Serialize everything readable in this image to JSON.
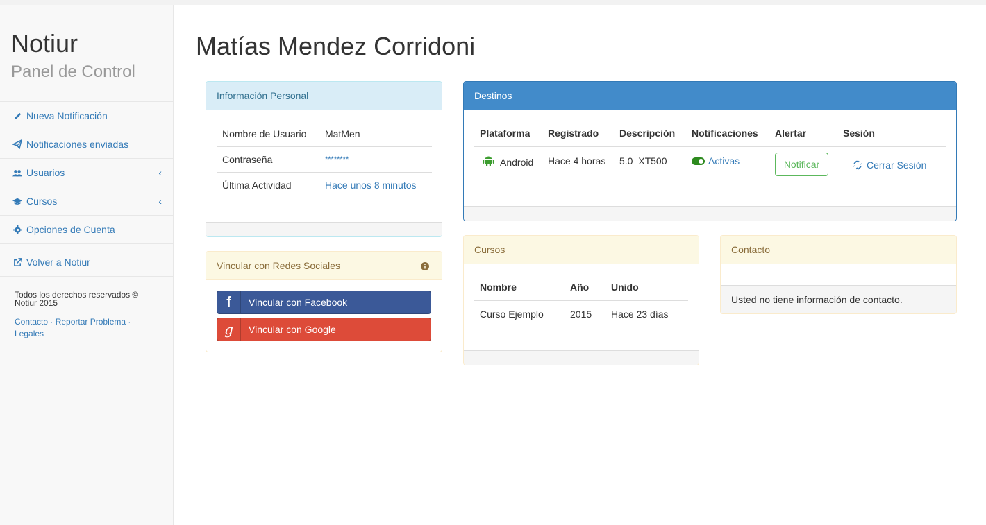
{
  "sidebar": {
    "brand_title": "Notiur",
    "brand_sub": "Panel de Control",
    "items": [
      {
        "label": "Nueva Notificación",
        "icon": "pencil-icon"
      },
      {
        "label": "Notificaciones enviadas",
        "icon": "paper-plane-icon"
      },
      {
        "label": "Usuarios",
        "icon": "users-icon"
      },
      {
        "label": "Cursos",
        "icon": "graduation-cap-icon"
      },
      {
        "label": "Opciones de Cuenta",
        "icon": "gear-icon"
      }
    ],
    "back_label": "Volver a Notiur",
    "footer_rights": "Todos los derechos reservados © Notiur 2015",
    "footer_links": "Contacto · Reportar Problema · Legales"
  },
  "main": {
    "title": "Matías Mendez Corridoni"
  },
  "personal": {
    "heading": "Información Personal",
    "rows": [
      {
        "key": "Nombre de Usuario",
        "value": "MatMen"
      },
      {
        "key": "Contraseña",
        "value": "********"
      },
      {
        "key": "Última Actividad",
        "value": "Hace unos 8 minutos"
      }
    ]
  },
  "social": {
    "heading": "Vincular con Redes Sociales",
    "facebook": "Vincular con Facebook",
    "google": "Vincular con Google"
  },
  "destinos": {
    "heading": "Destinos",
    "columns": [
      "Plataforma",
      "Registrado",
      "Descripción",
      "Notificaciones",
      "Alertar",
      "Sesión"
    ],
    "row": {
      "platform": "Android",
      "registered": "Hace 4 horas",
      "description": "5.0_XT500",
      "notifications": "Activas",
      "alert_button": "Notificar",
      "session_link": "Cerrar Sesión"
    }
  },
  "cursos": {
    "heading": "Cursos",
    "columns": [
      "Nombre",
      "Año",
      "Unido"
    ],
    "row": {
      "name": "Curso Ejemplo",
      "year": "2015",
      "joined": "Hace 23 días"
    }
  },
  "contacto": {
    "heading": "Contacto",
    "empty": "Usted no tiene información de contacto."
  },
  "colors": {
    "link": "#337ab7",
    "primary": "#428bca",
    "success": "#5cb85c",
    "facebook": "#3b5998",
    "google": "#dd4b39"
  }
}
